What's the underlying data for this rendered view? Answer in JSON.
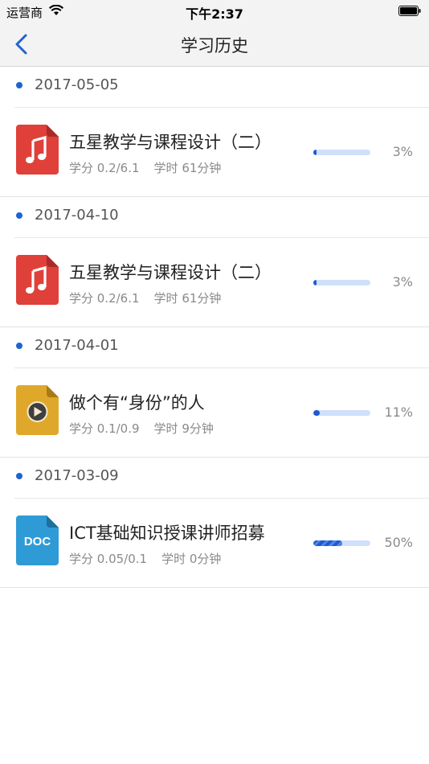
{
  "status_bar": {
    "carrier": "运营商",
    "time": "下午2:37"
  },
  "nav": {
    "title": "学习历史",
    "back_icon": "chevron-left-icon"
  },
  "colors": {
    "accent": "#1e64d2",
    "audio_icon": "#e0403a",
    "video_icon": "#e0a82a",
    "doc_icon": "#2f9bd6"
  },
  "groups": [
    {
      "date": "2017-05-05",
      "course": {
        "icon": "music-file-icon",
        "title": "五星教学与课程设计（二）",
        "credit": "学分 0.2/6.1",
        "hours": "学时 61分钟",
        "progress": 3,
        "progress_label": "3%"
      }
    },
    {
      "date": "2017-04-10",
      "course": {
        "icon": "music-file-icon",
        "title": "五星教学与课程设计（二）",
        "credit": "学分 0.2/6.1",
        "hours": "学时 61分钟",
        "progress": 3,
        "progress_label": "3%"
      }
    },
    {
      "date": "2017-04-01",
      "course": {
        "icon": "video-file-icon",
        "title": "做个有“身份”的人",
        "credit": "学分 0.1/0.9",
        "hours": "学时 9分钟",
        "progress": 11,
        "progress_label": "11%"
      }
    },
    {
      "date": "2017-03-09",
      "course": {
        "icon": "doc-file-icon",
        "doc_label": "DOC",
        "title": "ICT基础知识授课讲师招募",
        "credit": "学分 0.05/0.1",
        "hours": "学时 0分钟",
        "progress": 50,
        "progress_label": "50%"
      }
    }
  ]
}
